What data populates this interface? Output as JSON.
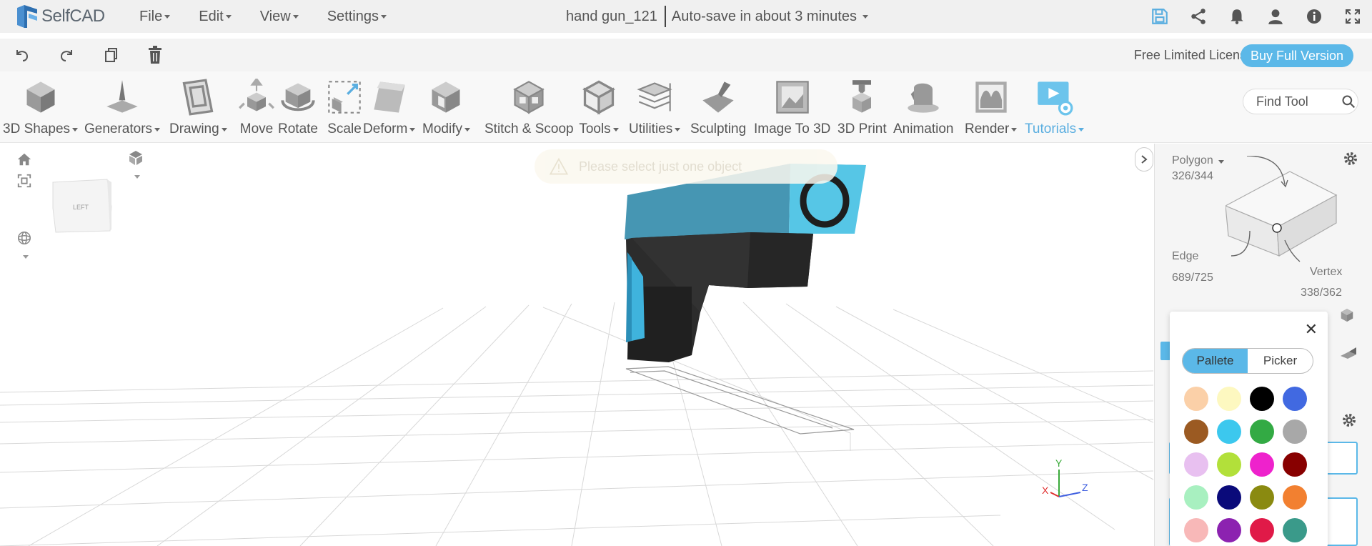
{
  "app": {
    "name": "SelfCAD"
  },
  "menu": [
    {
      "label": "File"
    },
    {
      "label": "Edit"
    },
    {
      "label": "View"
    },
    {
      "label": "Settings"
    }
  ],
  "project": {
    "name": "hand gun_121",
    "autosave": "Auto-save in about 3 minutes"
  },
  "top_icons": [
    "save-icon",
    "share-icon",
    "bell-icon",
    "user-icon",
    "info-icon",
    "fullscreen-icon"
  ],
  "subbar": {
    "icons": [
      "undo-icon",
      "redo-icon",
      "copy-icon",
      "delete-icon"
    ],
    "license": "Free Limited License",
    "buy_label": "Buy Full Version"
  },
  "tools": [
    {
      "label": "3D Shapes",
      "dropdown": true,
      "icon": "cube-icon"
    },
    {
      "label": "Generators",
      "dropdown": true,
      "icon": "generator-icon"
    },
    {
      "label": "Drawing",
      "dropdown": true,
      "icon": "drawing-icon"
    },
    {
      "label": "Move",
      "dropdown": false,
      "icon": "move-icon"
    },
    {
      "label": "Rotate",
      "dropdown": false,
      "icon": "rotate-icon"
    },
    {
      "label": "Scale",
      "dropdown": false,
      "icon": "scale-icon"
    },
    {
      "label": "Deform",
      "dropdown": true,
      "icon": "deform-icon"
    },
    {
      "label": "Modify",
      "dropdown": true,
      "icon": "modify-icon"
    },
    {
      "label": "Stitch & Scoop",
      "dropdown": false,
      "icon": "stitch-icon"
    },
    {
      "label": "Tools",
      "dropdown": true,
      "icon": "tools-icon"
    },
    {
      "label": "Utilities",
      "dropdown": true,
      "icon": "utilities-icon"
    },
    {
      "label": "Sculpting",
      "dropdown": false,
      "icon": "sculpting-icon"
    },
    {
      "label": "Image To 3D",
      "dropdown": false,
      "icon": "image-icon"
    },
    {
      "label": "3D Print",
      "dropdown": false,
      "icon": "print-icon"
    },
    {
      "label": "Animation",
      "dropdown": false,
      "icon": "animation-icon"
    },
    {
      "label": "Render",
      "dropdown": true,
      "icon": "render-icon"
    },
    {
      "label": "Tutorials",
      "dropdown": true,
      "icon": "tutorials-icon",
      "active": true
    }
  ],
  "find_tool": {
    "placeholder": "Find Tool"
  },
  "toast": {
    "message": "Please select just one object"
  },
  "view_cube": {
    "face": "LEFT"
  },
  "axes": {
    "x": "X",
    "y": "Y",
    "z": "Z"
  },
  "selection": {
    "polygon_label": "Polygon",
    "polygon_count": "326/344",
    "edge_label": "Edge",
    "edge_count": "689/725",
    "vertex_label": "Vertex",
    "vertex_count": "338/362"
  },
  "palette": {
    "tabs": [
      "Pallete",
      "Picker"
    ],
    "active_tab": "Pallete",
    "colors": [
      "#fbd0a8",
      "#fdf8c0",
      "#000000",
      "#4169e1",
      "#9b5a22",
      "#3cc8ee",
      "#33aa44",
      "#a8a8a8",
      "#e8c0f0",
      "#b2e03a",
      "#ee22cc",
      "#880000",
      "#a8f0c0",
      "#0a0a7a",
      "#8a8a10",
      "#f28030",
      "#f8b8b8",
      "#8c22b0",
      "#e01a48",
      "#3a9a8a"
    ]
  },
  "colors": {
    "accent": "#5bb8e8",
    "model_blue": "#4ec4e4",
    "model_dark": "#262626"
  }
}
